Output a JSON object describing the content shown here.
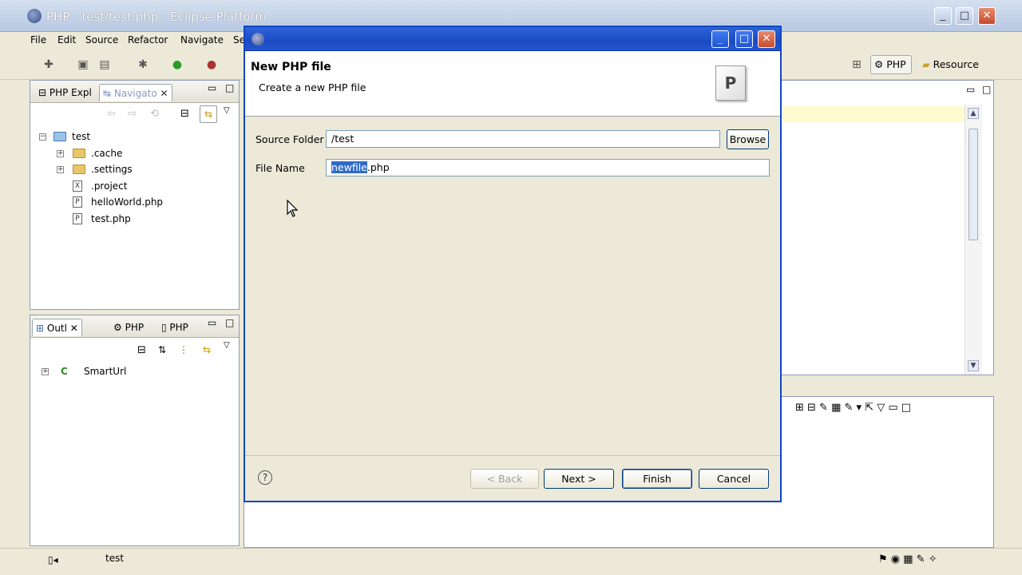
{
  "window": {
    "title": "PHP - test/test.php - Eclipse Platform",
    "minimize": "_",
    "maximize": "□",
    "close": "✕"
  },
  "menu": [
    {
      "label": "File"
    },
    {
      "label": "Edit"
    },
    {
      "label": "Source"
    },
    {
      "label": "Refactor"
    },
    {
      "label": "Navigate"
    },
    {
      "label": "Se"
    }
  ],
  "perspectives": {
    "php": "PHP",
    "resource": "Resource"
  },
  "navigator": {
    "tabs": [
      {
        "label": "PHP Expl"
      },
      {
        "label": "Navigato"
      }
    ],
    "tree": [
      {
        "label": "test",
        "level": 0,
        "icon": "project-icon",
        "expander": "−"
      },
      {
        "label": ".cache",
        "level": 1,
        "icon": "folder-icon",
        "expander": "+"
      },
      {
        "label": ".settings",
        "level": 1,
        "icon": "folder-icon",
        "expander": "+"
      },
      {
        "label": ".project",
        "level": 1,
        "icon": "xml-file-icon",
        "glyph": "X"
      },
      {
        "label": "helloWorld.php",
        "level": 1,
        "icon": "php-file-icon",
        "glyph": "P"
      },
      {
        "label": "test.php",
        "level": 1,
        "icon": "php-file-icon",
        "glyph": "P"
      }
    ]
  },
  "outline": {
    "tabs": [
      {
        "label": "Outl"
      },
      {
        "label": "PHP"
      },
      {
        "label": "PHP"
      }
    ],
    "tree": [
      {
        "label": "SmartUrl",
        "expander": "+",
        "icon": "class-icon",
        "glyph": "C"
      }
    ]
  },
  "dialog": {
    "header_title": "New PHP file",
    "header_desc": "Create a new PHP file",
    "header_icon": "P",
    "source_folder_label": "Source Folder",
    "source_folder_value": "/test",
    "browse_label": "Browse",
    "file_name_label": "File Name",
    "file_name_selected": "newfile",
    "file_name_rest": ".php",
    "help_glyph": "?",
    "buttons": {
      "back": "< Back",
      "next": "Next >",
      "finish": "Finish",
      "cancel": "Cancel"
    }
  },
  "status": {
    "text": "test"
  },
  "colors": {
    "titlebar": "#1b4bc3",
    "selection": "#316ac5"
  }
}
